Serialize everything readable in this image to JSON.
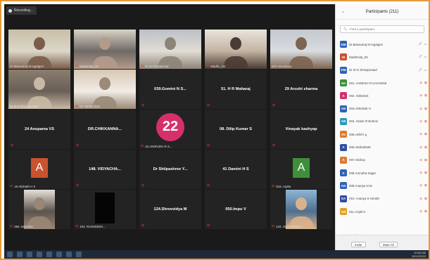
{
  "recording": {
    "label": "Recording..."
  },
  "tiles": [
    {
      "name": "",
      "caption": "Dr.Basavaraj M Ingalgeri",
      "type": "video",
      "active": true,
      "muted": false,
      "palette": [
        "#c9bfa8",
        "#7a5d4b",
        "#dcd6c9"
      ]
    },
    {
      "name": "",
      "caption": "Madhmita_03",
      "type": "video",
      "muted": true,
      "palette": [
        "#d8d2c6",
        "#b49a8a",
        "#6f6a66"
      ]
    },
    {
      "name": "",
      "caption": "Dr.M.Shivakumar",
      "type": "video",
      "muted": true,
      "palette": [
        "#bcc0c6",
        "#8d8478",
        "#e1dcd4"
      ]
    },
    {
      "name": "",
      "caption": "Madhu_B3",
      "type": "video",
      "muted": true,
      "palette": [
        "#e9e4dc",
        "#4a3b35",
        "#c4b3a2"
      ]
    },
    {
      "name": "",
      "caption": "ahir srivastava",
      "type": "video",
      "muted": false,
      "palette": [
        "#c3c8cf",
        "#7b6450",
        "#d9dcdf"
      ]
    },
    {
      "name": "",
      "caption": "Dr M G Shivaprasad",
      "type": "video",
      "muted": false,
      "palette": [
        "#8a7d70",
        "#c9b9a4",
        "#6a5f57"
      ]
    },
    {
      "name": "",
      "caption": "Dr. Sarita Bhat",
      "type": "video",
      "muted": true,
      "palette": [
        "#d6c7b3",
        "#9b8a77",
        "#f1ece6"
      ]
    },
    {
      "name": "039.Gomini N S...",
      "caption": "",
      "type": "name",
      "muted": true
    },
    {
      "name": "51. H R Maharaj",
      "caption": "",
      "type": "name",
      "muted": true
    },
    {
      "name": "29 Arushi sharma",
      "caption": "",
      "type": "name",
      "muted": true
    },
    {
      "name": "24 Anupama VS",
      "caption": "",
      "type": "name",
      "muted": true
    },
    {
      "name": "DR.CHIKKANNA...",
      "caption": "",
      "type": "name",
      "muted": true
    },
    {
      "name": "22",
      "caption": "22.ANIRUDH R S...",
      "type": "circle",
      "muted": true,
      "color": "#d4306c"
    },
    {
      "name": "08. Dilip Kumar S",
      "caption": "",
      "type": "name",
      "muted": true
    },
    {
      "name": "Vinayak kashyap",
      "caption": "",
      "type": "name",
      "muted": true
    },
    {
      "name": "A",
      "caption": "19 Akshath H S",
      "type": "avatar",
      "muted": true,
      "color": "#c9532e"
    },
    {
      "name": "148. VIDYACHA...",
      "caption": "",
      "type": "name",
      "muted": true
    },
    {
      "name": "Dr Shilpashree Y...",
      "caption": "",
      "type": "name",
      "muted": true
    },
    {
      "name": "41 Damini H S",
      "caption": "",
      "type": "name",
      "muted": true
    },
    {
      "name": "A",
      "caption": "016. Arpita",
      "type": "avatar",
      "muted": true,
      "color": "#3f8f3a"
    },
    {
      "name": "",
      "caption": "066. Manisha",
      "type": "photo",
      "muted": true,
      "palette": [
        "#e6e0d8",
        "#9a8676",
        "#5d544e"
      ]
    },
    {
      "name": "",
      "caption": "104. RASHMISH...",
      "type": "blank",
      "muted": true
    },
    {
      "name": "124.Shreevidya M",
      "caption": "",
      "type": "name",
      "muted": true
    },
    {
      "name": "050.Impu V",
      "caption": "",
      "type": "name",
      "muted": true
    },
    {
      "name": "",
      "caption": "134. SUGUNESH...",
      "type": "photo",
      "muted": true,
      "palette": [
        "#8fb6d6",
        "#d9b38c",
        "#4f6f8f"
      ]
    }
  ],
  "participants_panel": {
    "title": "Participants (211)",
    "search_placeholder": "Find a participant",
    "participants": [
      {
        "initials": "DM",
        "color": "#2f63b3",
        "name": "Dr.Basavaraj M Ingalgeri",
        "status": "gray"
      },
      {
        "initials": "M",
        "color": "#c9532e",
        "name": "Madhmita_03",
        "status": "gray"
      },
      {
        "initials": "DM",
        "color": "#2f63b3",
        "name": "Dr M G Shivaprasad",
        "status": "gray"
      },
      {
        "initials": "AK",
        "color": "#3f8f3a",
        "name": "001. AADESH R KAVANNE",
        "status": "red"
      },
      {
        "initials": "A",
        "color": "#d4306c",
        "name": "002. Abhishek",
        "status": "red"
      },
      {
        "initials": "AN",
        "color": "#2f63b3",
        "name": "003.Abhishek H",
        "status": "red"
      },
      {
        "initials": "AB",
        "color": "#2a9bb5",
        "name": "004. Akash R Bohmri",
        "status": "red"
      },
      {
        "initials": "AV",
        "color": "#e07a2b",
        "name": "005.Akhil k g",
        "status": "red"
      },
      {
        "initials": "A",
        "color": "#2f4fa0",
        "name": "006.AkshathaM",
        "status": "red"
      },
      {
        "initials": "A",
        "color": "#e07a2b",
        "name": "007.Akshay",
        "status": "red"
      },
      {
        "initials": "A",
        "color": "#2f63b3",
        "name": "008.Amrutha Sagar",
        "status": "red"
      },
      {
        "initials": "AN",
        "color": "#2f63b3",
        "name": "009.Ananya N M",
        "status": "red"
      },
      {
        "initials": "SA",
        "color": "#2f4fa0",
        "name": "010. Ananya S Herath",
        "status": "red"
      },
      {
        "initials": "AN",
        "color": "#e0a02b",
        "name": "011.Anjali H",
        "status": "red"
      }
    ],
    "activate_text": "Activate Windows\nGo to Settings to activate Windows.",
    "invite_label": "Invite",
    "mute_all_label": "Mute All"
  },
  "taskbar": {
    "time": "10:06 AM",
    "date": "10/12/2020"
  }
}
